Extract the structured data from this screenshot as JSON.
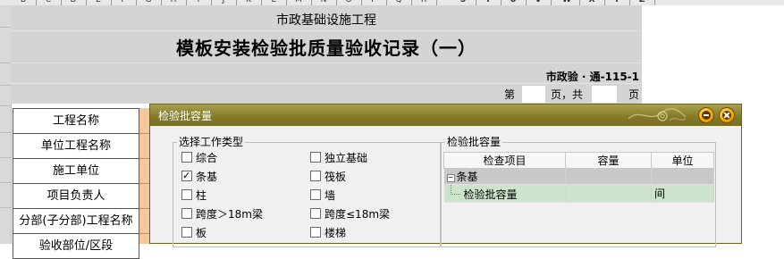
{
  "spreadsheet": {
    "column_headers": [
      "B",
      "C",
      "D",
      "E",
      "F",
      "G",
      "H",
      "I",
      "J",
      "K",
      "L",
      "M",
      "N",
      "O",
      "P",
      "Q",
      "R",
      "S",
      "T",
      "U",
      "V",
      "W",
      "X",
      "Y",
      "Z"
    ],
    "project_type": "市政基础设施工程",
    "form_title": "模板安装检验批质量验收记录（一）",
    "form_code": "市政验 · 通-115-1",
    "page_label_prefix": "第",
    "page_label_mid": "页，共",
    "page_label_suffix": "页",
    "field_labels": [
      "工程名称",
      "单位工程名称",
      "施工单位",
      "项目负责人",
      "分部(子分部)工程名称",
      "验收部位/区段"
    ]
  },
  "dialog": {
    "title": "检验批容量",
    "work_type_group": {
      "legend": "选择工作类型",
      "options": [
        {
          "label": "综合",
          "checked": false
        },
        {
          "label": "独立基础",
          "checked": false
        },
        {
          "label": "条基",
          "checked": true
        },
        {
          "label": "筏板",
          "checked": false
        },
        {
          "label": "柱",
          "checked": false
        },
        {
          "label": "墙",
          "checked": false
        },
        {
          "label": "跨度＞18m梁",
          "checked": false
        },
        {
          "label": "跨度≤18m梁",
          "checked": false
        },
        {
          "label": "板",
          "checked": false
        },
        {
          "label": "楼梯",
          "checked": false
        }
      ]
    },
    "capacity_group": {
      "legend": "检验批容量",
      "columns": [
        "检查项目",
        "容量",
        "单位"
      ],
      "rows": [
        {
          "type": "group",
          "expand_symbol": "⊟",
          "item": "条基",
          "capacity": "",
          "unit": ""
        },
        {
          "type": "item",
          "item": "检验批容量",
          "capacity": "",
          "unit": "间"
        }
      ]
    },
    "colors": {
      "titlebar": "#857c2a",
      "group_row": "#c8c8c8",
      "item_row": "#cde4cc",
      "form_label_accent": "#f2c89c"
    },
    "icons": [
      "minimize-icon",
      "close-icon",
      "checkbox-icon",
      "tree-collapse-icon"
    ]
  }
}
